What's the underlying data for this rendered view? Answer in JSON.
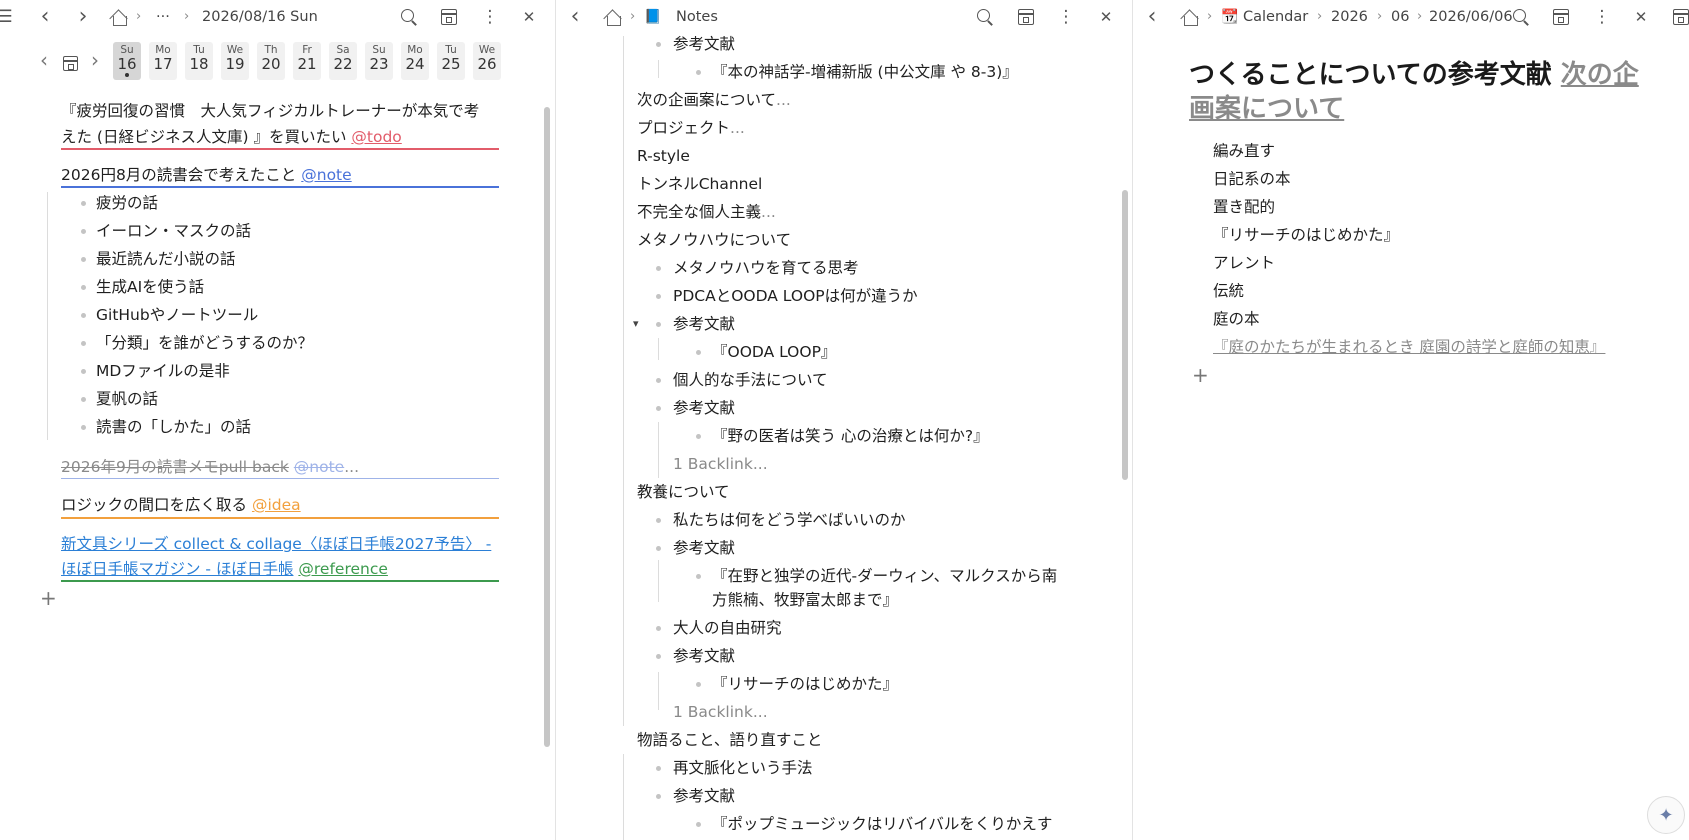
{
  "left": {
    "toolbar": {
      "menu": "☰",
      "back": "‹",
      "fwd": "›",
      "ellipsis": "···",
      "title": "2026/08/16 Sun",
      "more": "⋮",
      "close": "✕"
    },
    "calendar": {
      "prev": "‹",
      "next": "›",
      "days": [
        {
          "wd": "Su",
          "d": "16"
        },
        {
          "wd": "Mo",
          "d": "17"
        },
        {
          "wd": "Tu",
          "d": "18"
        },
        {
          "wd": "We",
          "d": "19"
        },
        {
          "wd": "Th",
          "d": "20"
        },
        {
          "wd": "Fr",
          "d": "21"
        },
        {
          "wd": "Sa",
          "d": "22"
        },
        {
          "wd": "Su",
          "d": "23"
        },
        {
          "wd": "Mo",
          "d": "24"
        },
        {
          "wd": "Tu",
          "d": "25"
        },
        {
          "wd": "We",
          "d": "26"
        }
      ]
    },
    "b1_line1": "『疲労回復の習慣　大人気フィジカルトレーナーが本気で考",
    "b1_line2": "えた (日経ビジネス人文庫) 』を買いたい",
    "b1_tag": "@todo",
    "b2_text": "2026円8月の読書会で考えたこと",
    "b2_tag": "@note",
    "b2_items": [
      "疲労の話",
      "イーロン・マスクの話",
      "最近読んだ小説の話",
      "生成AIを使う話",
      "GitHubやノートツール",
      "「分類」を誰がどうするのか？",
      "MDファイルの是非",
      "夏帆の話",
      "読書の「しかた」の話"
    ],
    "b3_text": "2026年9月の読書メモpull back",
    "b3_tag": "@note",
    "b3_more": "...",
    "b4_text": "ロジックの間口を広く取る",
    "b4_tag": "@idea",
    "b5_line1": "新文具シリーズ collect & collage〈ほぼ日手帳2027予告〉 -",
    "b5_line2": "ほぼ日手帳マガジン - ほぼ日手帳",
    "b5_tag": "@reference",
    "plus": "+"
  },
  "mid": {
    "toolbar": {
      "back": "‹",
      "notebook_icon": "📘",
      "title": "Notes",
      "more": "⋮",
      "close": "✕"
    },
    "lines": [
      "参考文献",
      "『本の神話学-増補新版 (中公文庫 や 8-3)』",
      "次の企画案について",
      "プロジェクト",
      "R-style",
      "トンネルChannel",
      "不完全な個人主義",
      "メタノウハウについて",
      "メタノウハウを育てる思考",
      "PDCAとOODA LOOPは何が違うか",
      "参考文献",
      "『OODA LOOP』",
      "個人的な手法について",
      "参考文献",
      "『野の医者は笑う 心の治療とは何か?』",
      "1 Backlink",
      "教養について",
      "私たちは何をどう学べばいいのか",
      "参考文献",
      "『在野と独学の近代-ダーウィン、マルクスから南",
      "方熊楠、牧野富太郎まで』",
      "大人の自由研究",
      "参考文献",
      "『リサーチのはじめかた』",
      "1 Backlink",
      "物語ること、語り直すこと",
      "再文脈化という手法",
      "参考文献",
      "『ポップミュージックはリバイバルをくりかえす"
    ],
    "ellipsis": "...",
    "toggle": "▾"
  },
  "right": {
    "toolbar": {
      "back": "‹",
      "cal_icon": "📆",
      "crumbs": [
        "Calendar",
        "2026",
        "06",
        "2026/06/06"
      ],
      "more": "⋮",
      "close": "✕"
    },
    "heading_text": "つくることについての参考文献",
    "heading_link_1": "次の企",
    "heading_link_2": "画案について",
    "items": [
      "編み直す",
      "日記系の本",
      "置き配的",
      "『リサーチのはじめかた』",
      "アレント",
      "伝統",
      "庭の本"
    ],
    "link_item": "『庭のかたちが生まれるとき 庭園の詩学と庭師の知恵』",
    "plus": "+",
    "ai": "✦"
  },
  "colors": {
    "todo": "#e25c6a",
    "note": "#4a72d9",
    "idea": "#f2a03d",
    "reference": "#3c9a4e",
    "link": "#2b7fd6"
  }
}
